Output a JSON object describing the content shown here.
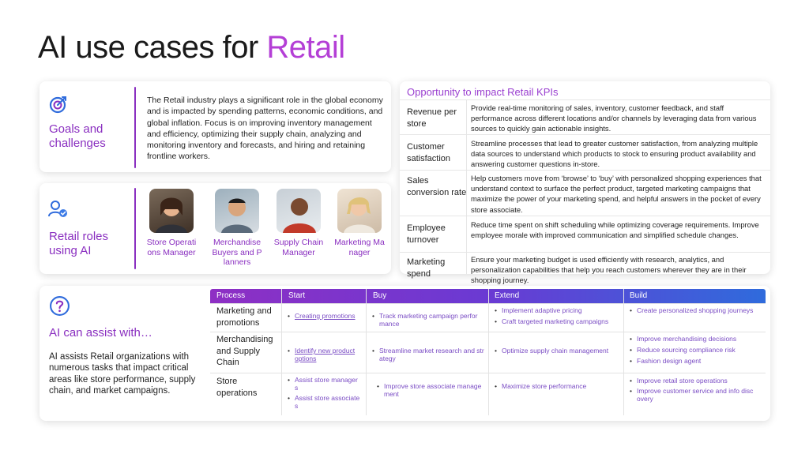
{
  "title": {
    "prefix": "AI use cases for ",
    "accent": "Retail"
  },
  "goals": {
    "heading": "Goals and challenges",
    "text": "The Retail industry plays a significant role in the global economy and is impacted by spending patterns, economic conditions, and global inflation. Focus is on improving inventory management and efficiency, optimizing their supply chain, analyzing and monitoring inventory and forecasts, and hiring and retaining frontline workers."
  },
  "roles": {
    "heading": "Retail roles using AI",
    "items": [
      {
        "label": "Store Operations Manager",
        "icon": "person-photo"
      },
      {
        "label": "Merchandise Buyers and Planners",
        "icon": "person-photo"
      },
      {
        "label": "Supply Chain Manager",
        "icon": "person-photo"
      },
      {
        "label": "Marketing Manager",
        "icon": "person-photo"
      }
    ]
  },
  "kpi": {
    "title": "Opportunity to impact Retail KPIs",
    "rows": [
      {
        "name": "Revenue per store",
        "desc": "Provide real-time monitoring of sales, inventory, customer feedback, and staff performance across different locations and/or channels by leveraging data from various sources to quickly gain actionable insights."
      },
      {
        "name": "Customer satisfaction",
        "desc": "Streamline processes that lead to greater customer satisfaction, from analyzing multiple data sources to understand which products to stock to ensuring product availability and answering customer questions in-store."
      },
      {
        "name": "Sales conversion rate",
        "desc": "Help customers move from ‘browse’ to ‘buy’ with personalized shopping experiences that understand context to surface the perfect product, targeted marketing campaigns that maximize the power of your marketing spend, and helpful answers in the pocket of every store associate."
      },
      {
        "name": "Employee turnover",
        "desc": "Reduce time spent on shift scheduling while optimizing coverage requirements. Improve employee morale with improved communication and simplified schedule changes."
      },
      {
        "name": "Marketing spend",
        "desc": "Ensure your marketing budget is used efficiently with research, analytics, and personalization capabilities that help you reach customers wherever they are in their shopping journey."
      }
    ]
  },
  "assist": {
    "heading": "AI can assist with…",
    "text": "AI assists Retail organizations with numerous tasks that impact critical areas like store performance, supply chain, and market campaigns."
  },
  "process": {
    "headers": [
      "Process",
      "Start",
      "Buy",
      "Extend",
      "Build"
    ],
    "rows": [
      {
        "name": "Marketing and promotions",
        "start": [
          "Creating promotions"
        ],
        "buy": [
          "Track marketing campaign performance"
        ],
        "extend": [
          "Implement adaptive pricing",
          "Craft targeted marketing campaigns"
        ],
        "build": [
          "Create personalized shopping journeys"
        ]
      },
      {
        "name": "Merchandising and Supply Chain",
        "start": [
          "Identify new product options"
        ],
        "buy": [
          "Streamline market research and strategy"
        ],
        "extend": [
          "Optimize supply chain management"
        ],
        "build": [
          "Improve merchandising decisions",
          "Reduce sourcing compliance risk",
          "Fashion design agent"
        ]
      },
      {
        "name": "Store operations",
        "start": [
          "Assist store managers",
          "Assist store associates"
        ],
        "buy": [
          "Improve store associate management"
        ],
        "extend": [
          "Maximize store performance"
        ],
        "build": [
          "Improve retail store operations",
          "Improve customer service and info discovery"
        ]
      }
    ]
  },
  "colors": {
    "accent": "#b43fd6",
    "heading": "#8a2fc0",
    "link": "#7a4cc4",
    "header_start": "#8e2fc4",
    "header_end": "#2f6bdc"
  }
}
